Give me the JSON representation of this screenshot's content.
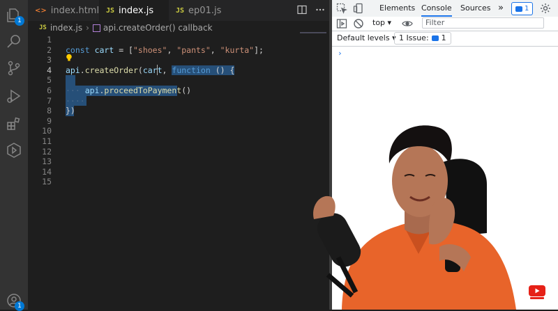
{
  "editor": {
    "activity_badges": {
      "explorer": "1",
      "accounts": "1"
    },
    "tabs": [
      {
        "icon": "<>",
        "label": "index.html",
        "active": false
      },
      {
        "icon": "JS",
        "label": "index.js",
        "active": true,
        "modified": true
      },
      {
        "icon": "JS",
        "label": "ep01.js",
        "active": false
      }
    ],
    "breadcrumb": {
      "file_icon": "JS",
      "file": "index.js",
      "symbol": "api.createOrder() callback"
    },
    "line_numbers": [
      "1",
      "2",
      "3",
      "4",
      "5",
      "6",
      "7",
      "8",
      "9",
      "10",
      "11",
      "12",
      "13",
      "14",
      "15"
    ],
    "code": {
      "line2": {
        "const": "const",
        "name": "cart",
        "eq": " = [",
        "s1": "\"shoes\"",
        "c1": ", ",
        "s2": "\"pants\"",
        "c2": ", ",
        "s3": "\"kurta\"",
        "end": "];"
      },
      "line4": {
        "obj": "api",
        "dot": ".",
        "fn": "createOrder",
        "open": "(",
        "arg": "cart",
        "comma": ", ",
        "kw": "function",
        "rest": " () {"
      },
      "line6": {
        "obj": "api",
        "dot": ".",
        "fn": "proceedToPayment",
        "call": "()"
      },
      "line8": {
        "close": "})"
      }
    }
  },
  "devtools": {
    "tabs": [
      "Elements",
      "Console",
      "Sources"
    ],
    "active_tab": "Console",
    "more": "»",
    "messages_count": "1",
    "context": "top ▾",
    "filter_placeholder": "Filter",
    "levels": "Default levels ▾",
    "issues": "1 Issue:",
    "issues_count": "1",
    "prompt": "›"
  },
  "colors": {
    "editor_bg": "#1e1e1e",
    "keyword": "#569cd6",
    "variable": "#9cdcfe",
    "function": "#dcdcaa",
    "string": "#ce9178",
    "selection": "#264f78",
    "devtools_accent": "#1a73e8"
  }
}
